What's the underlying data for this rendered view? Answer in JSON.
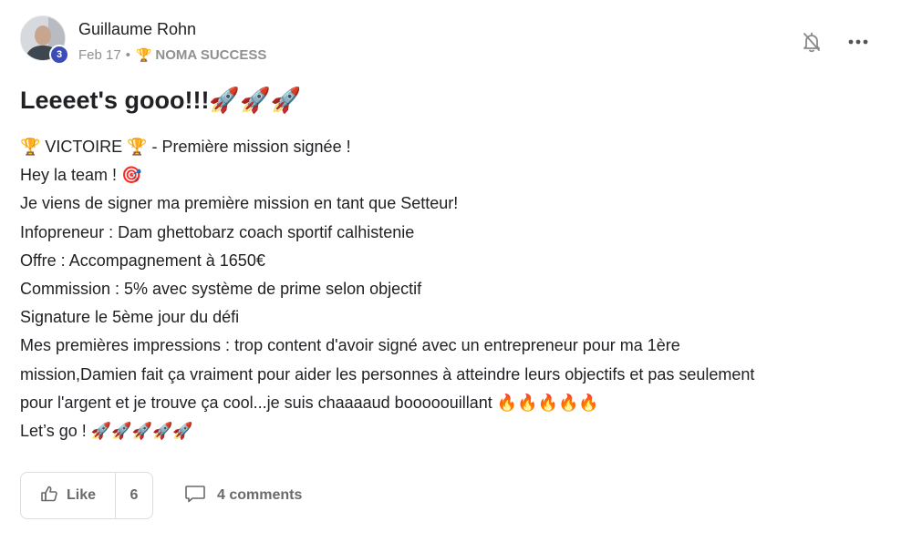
{
  "post": {
    "author": "Guillaume Rohn",
    "level": "3",
    "date": "Feb 17",
    "separator": "•",
    "category_icon": "🏆",
    "category": "NOMA SUCCESS",
    "title": "Leeeet's gooo!!!🚀🚀🚀",
    "body_lines": [
      "🏆 VICTOIRE 🏆 - Première mission signée !",
      "Hey la team ! 🎯",
      "Je viens de signer ma première mission en tant que Setteur!",
      "Infopreneur : Dam ghettobarz coach sportif calhistenie",
      "Offre : Accompagnement à 1650€",
      "Commission : 5% avec système de prime selon objectif",
      "Signature le 5ème jour du défi",
      "Mes premières impressions : trop content d'avoir signé avec un entrepreneur pour ma 1ère",
      "mission,Damien fait ça vraiment pour aider les personnes à atteindre leurs objectifs et pas seulement",
      "pour l'argent et je trouve ça cool...je suis chaaaaud booooouillant 🔥🔥🔥🔥🔥",
      "Let’s go ! 🚀🚀🚀🚀🚀"
    ],
    "like_label": "Like",
    "like_count": "6",
    "comments_label": "4 comments"
  },
  "icons": {
    "bell": "bell-off-icon",
    "more": "more-horizontal-icon",
    "like": "thumbs-up-icon",
    "comment": "comment-icon"
  },
  "colors": {
    "badge": "#3b4bb8",
    "muted": "#909090",
    "text": "#202124"
  }
}
